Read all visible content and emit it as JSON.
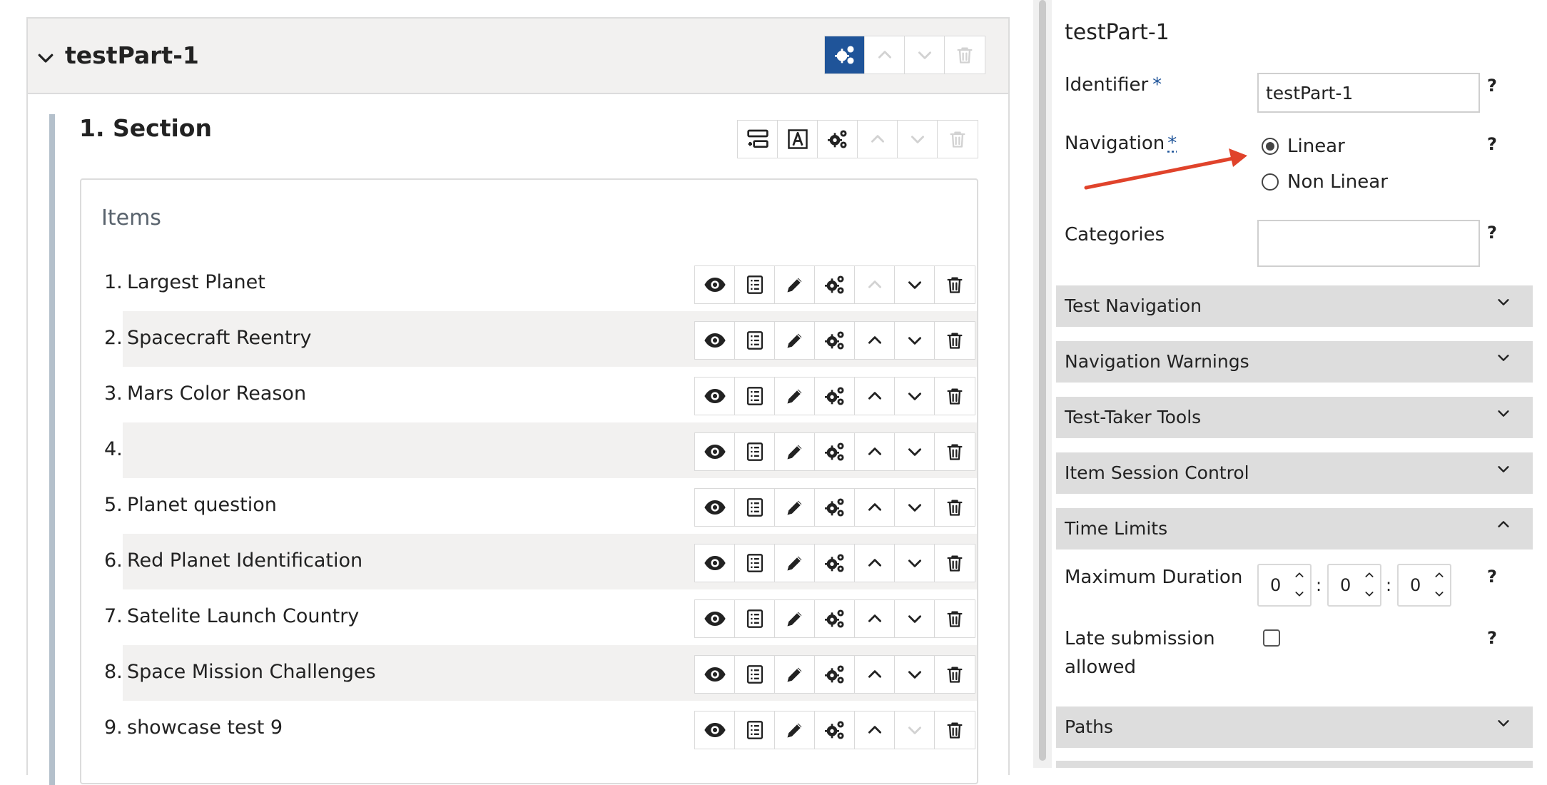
{
  "test_part": {
    "title": "testPart-1"
  },
  "section": {
    "title": "1. Section"
  },
  "items": {
    "title": "Items",
    "rows": [
      {
        "num": "1.",
        "label": "Largest Planet"
      },
      {
        "num": "2.",
        "label": "Spacecraft Reentry"
      },
      {
        "num": "3.",
        "label": "Mars Color Reason"
      },
      {
        "num": "4.",
        "label": ""
      },
      {
        "num": "5.",
        "label": "Planet question"
      },
      {
        "num": "6.",
        "label": "Red Planet Identification"
      },
      {
        "num": "7.",
        "label": "Satelite Launch Country"
      },
      {
        "num": "8.",
        "label": "Space Mission Challenges"
      },
      {
        "num": "9.",
        "label": "showcase test 9"
      }
    ]
  },
  "properties": {
    "title": "testPart-1",
    "identifier_label": "Identifier",
    "identifier_value": "testPart-1",
    "required_mark": "*",
    "navigation_label": "Navigation",
    "navigation_options": [
      "Linear",
      "Non Linear"
    ],
    "navigation_selected": "Linear",
    "categories_label": "Categories",
    "categories_value": "",
    "help": "?",
    "sections": [
      {
        "title": "Test Navigation",
        "expanded": false
      },
      {
        "title": "Navigation Warnings",
        "expanded": false
      },
      {
        "title": "Test-Taker Tools",
        "expanded": false
      },
      {
        "title": "Item Session Control",
        "expanded": false
      },
      {
        "title": "Time Limits",
        "expanded": true
      },
      {
        "title": "Paths",
        "expanded": false
      }
    ],
    "max_duration_label": "Maximum Duration",
    "max_duration": {
      "hours": "0",
      "minutes": "0",
      "seconds": "0",
      "separator": ":"
    },
    "late_submission_label_1": "Late submission",
    "late_submission_label_2": "allowed",
    "late_submission_checked": false
  },
  "colors": {
    "accent": "#1f5499",
    "annotation_arrow": "#e0432b"
  }
}
